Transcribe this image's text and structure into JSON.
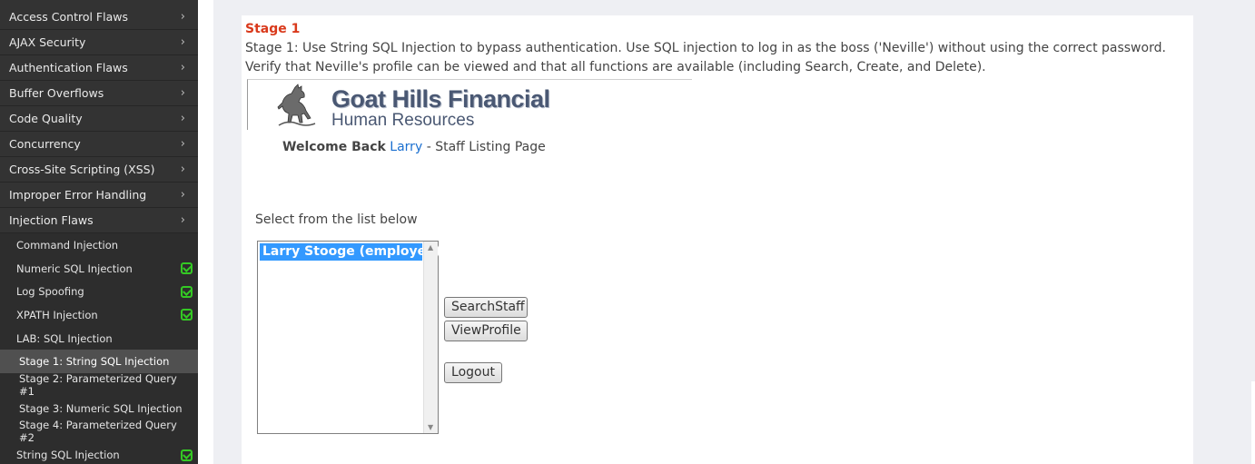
{
  "sidebar": {
    "categories": [
      {
        "label": "Access Control Flaws"
      },
      {
        "label": "AJAX Security"
      },
      {
        "label": "Authentication Flaws"
      },
      {
        "label": "Buffer Overflows"
      },
      {
        "label": "Code Quality"
      },
      {
        "label": "Concurrency"
      },
      {
        "label": "Cross-Site Scripting (XSS)"
      },
      {
        "label": "Improper Error Handling"
      },
      {
        "label": "Injection Flaws"
      }
    ],
    "lessons": [
      {
        "label": "Command Injection",
        "completed": false
      },
      {
        "label": "Numeric SQL Injection",
        "completed": true
      },
      {
        "label": "Log Spoofing",
        "completed": true
      },
      {
        "label": "XPATH Injection",
        "completed": true
      },
      {
        "label": "LAB: SQL Injection",
        "completed": false
      }
    ],
    "stages": [
      {
        "label": "Stage 1: String SQL Injection",
        "active": true
      },
      {
        "label": "Stage 2: Parameterized Query #1",
        "active": false
      },
      {
        "label": "Stage 3: Numeric SQL Injection",
        "active": false
      },
      {
        "label": "Stage 4: Parameterized Query #2",
        "active": false
      }
    ],
    "last_lesson": {
      "label": "String SQL Injection",
      "completed": true
    },
    "chevron": "›"
  },
  "content": {
    "stage_title": "Stage 1",
    "stage_description": "Stage 1: Use String SQL Injection to bypass authentication. Use SQL injection to log in as the boss ('Neville') without using the correct password. Verify that Neville's profile can be viewed and that all functions are available (including Search, Create, and Delete)."
  },
  "app": {
    "logo_icon": "goat-icon",
    "company_name": "Goat Hills Financial",
    "company_sub": "Human Resources",
    "welcome_prefix": "Welcome Back",
    "user_name": "Larry",
    "welcome_suffix": "- Staff Listing Page",
    "select_label": "Select from the list below",
    "staff_list": [
      "Larry Stooge (employee)"
    ],
    "buttons": {
      "search": "SearchStaff",
      "view": "ViewProfile",
      "logout": "Logout"
    }
  },
  "colors": {
    "sidebar_bg": "#323232",
    "active_item": "#505050",
    "check": "#34c924",
    "stage_title": "#d9391b",
    "link": "#1a6fd0",
    "selection": "#3399ff"
  }
}
